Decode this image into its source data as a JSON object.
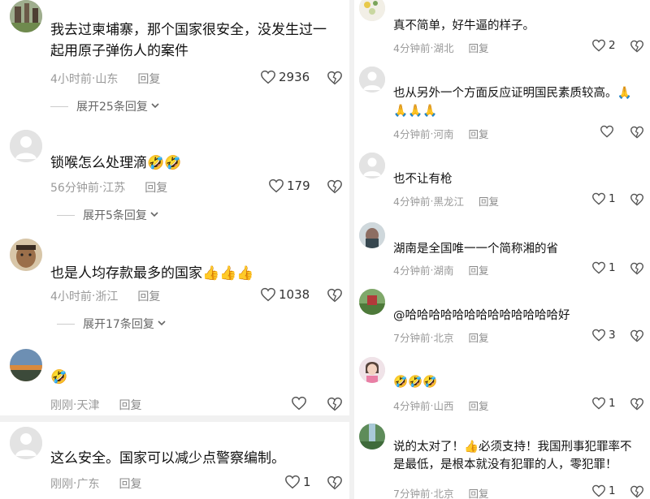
{
  "left": [
    {
      "text": "我去过柬埔寨，那个国家很安全，没发生过一起用原子弹伤人的案件",
      "time": "4小时前",
      "loc": "山东",
      "reply": "回复",
      "likes": "2936",
      "expand": "展开25条回复"
    },
    {
      "text": "锁喉怎么处理滴🤣🤣",
      "time": "56分钟前",
      "loc": "江苏",
      "reply": "回复",
      "likes": "179",
      "expand": "展开5条回复"
    },
    {
      "text": "也是人均存款最多的国家👍👍👍",
      "time": "4小时前",
      "loc": "浙江",
      "reply": "回复",
      "likes": "1038",
      "expand": "展开17条回复"
    },
    {
      "text": "🤣",
      "time": "刚刚",
      "loc": "天津",
      "reply": "回复",
      "likes": "",
      "expand": ""
    },
    {
      "text": "这么安全。国家可以减少点警察编制。",
      "time": "刚刚",
      "loc": "广东",
      "reply": "回复",
      "likes": "1",
      "expand": ""
    }
  ],
  "right": [
    {
      "text": "真不简单，好牛逼的样子。",
      "time": "4分钟前",
      "loc": "湖北",
      "reply": "回复",
      "likes": "2"
    },
    {
      "text": "也从另外一个方面反应证明国民素质较高。🙏🙏🙏🙏",
      "time": "4分钟前",
      "loc": "河南",
      "reply": "回复",
      "likes": ""
    },
    {
      "text": "也不让有枪",
      "time": "4分钟前",
      "loc": "黑龙江",
      "reply": "回复",
      "likes": "1"
    },
    {
      "text": "湖南是全国唯一一个简称湘的省",
      "time": "4分钟前",
      "loc": "湖南",
      "reply": "回复",
      "likes": "1"
    },
    {
      "text": "@哈哈哈哈哈哈哈哈哈哈哈哈哈好",
      "time": "7分钟前",
      "loc": "北京",
      "reply": "回复",
      "likes": "3"
    },
    {
      "text": "🤣🤣🤣",
      "time": "4分钟前",
      "loc": "山西",
      "reply": "回复",
      "likes": "1"
    },
    {
      "text": "说的太对了！👍必须支持！我国刑事犯罪率不是最低，是根本就没有犯罪的人，零犯罪！",
      "time": "7分钟前",
      "loc": "北京",
      "reply": "回复",
      "likes": "1"
    }
  ],
  "separator": " · ",
  "icons": {
    "like": "heart-outline-icon",
    "dislike": "broken-heart-icon",
    "expand": "chevron-down-icon"
  }
}
